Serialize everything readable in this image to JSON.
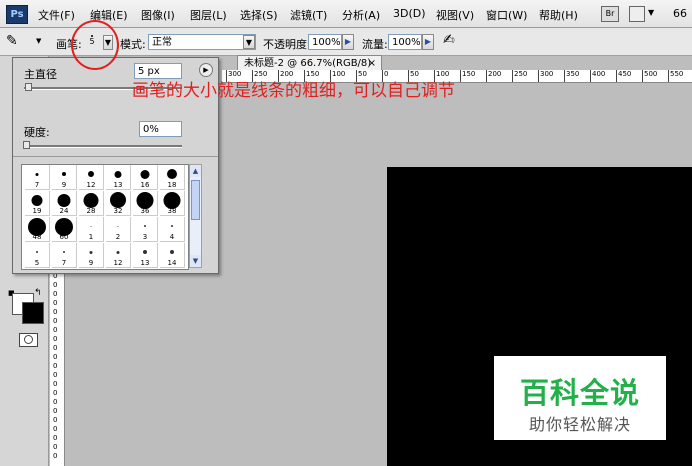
{
  "app": {
    "logo": "Ps"
  },
  "menu": [
    {
      "label": "文件(F)"
    },
    {
      "label": "编辑(E)"
    },
    {
      "label": "图像(I)"
    },
    {
      "label": "图层(L)"
    },
    {
      "label": "选择(S)"
    },
    {
      "label": "滤镜(T)"
    },
    {
      "label": "分析(A)"
    },
    {
      "label": "3D(D)"
    },
    {
      "label": "视图(V)"
    },
    {
      "label": "窗口(W)"
    },
    {
      "label": "帮助(H)"
    }
  ],
  "topright": {
    "bridge_label": "Br",
    "zoom": "66"
  },
  "options": {
    "brush_label": "画笔:",
    "brush_size_value": "5",
    "mode_label": "模式:",
    "mode_value": "正常",
    "opacity_label": "不透明度:",
    "opacity_value": "100%",
    "flow_label": "流量:",
    "flow_value": "100%"
  },
  "document": {
    "tab_title": "未标题-2 @ 66.7%(RGB/8)",
    "close": "×"
  },
  "ruler_h": [
    "300",
    "250",
    "200",
    "150",
    "100",
    "50",
    "0",
    "50",
    "100",
    "150",
    "200",
    "250",
    "300",
    "350",
    "400",
    "450",
    "500",
    "550"
  ],
  "ruler_v": [
    "0",
    "0",
    "0",
    "0",
    "0",
    "0",
    "0",
    "0",
    "0",
    "0",
    "0",
    "0",
    "0",
    "0",
    "0",
    "0",
    "0",
    "0",
    "0",
    "0",
    "0"
  ],
  "brush_panel": {
    "diameter_label": "主直径",
    "diameter_value": "5 px",
    "hardness_label": "硬度:",
    "hardness_value": "0%",
    "menu_arrow": "▶"
  },
  "brush_presets": [
    {
      "size": "7",
      "d": 3
    },
    {
      "size": "9",
      "d": 4
    },
    {
      "size": "12",
      "d": 6
    },
    {
      "size": "13",
      "d": 7
    },
    {
      "size": "16",
      "d": 9
    },
    {
      "size": "18",
      "d": 10
    },
    {
      "size": "19",
      "d": 11
    },
    {
      "size": "24",
      "d": 13
    },
    {
      "size": "28",
      "d": 15
    },
    {
      "size": "32",
      "d": 16
    },
    {
      "size": "36",
      "d": 17
    },
    {
      "size": "38",
      "d": 17
    },
    {
      "size": "48",
      "d": 18
    },
    {
      "size": "60",
      "d": 18
    },
    {
      "size": "1",
      "d": 1
    },
    {
      "size": "2",
      "d": 1
    },
    {
      "size": "3",
      "d": 2
    },
    {
      "size": "4",
      "d": 2
    },
    {
      "size": "5",
      "d": 2
    },
    {
      "size": "7",
      "d": 2
    },
    {
      "size": "9",
      "d": 3
    },
    {
      "size": "12",
      "d": 3
    },
    {
      "size": "13",
      "d": 4
    },
    {
      "size": "14",
      "d": 4
    }
  ],
  "annotation": "画笔的大小就是线条的粗细，可以自己调节",
  "watermark": {
    "title": "百科全说",
    "subtitle": "助你轻松解决"
  },
  "colors": {
    "annotation_red": "#e02020",
    "watermark_green": "#23b04a",
    "canvas": "#000000"
  }
}
